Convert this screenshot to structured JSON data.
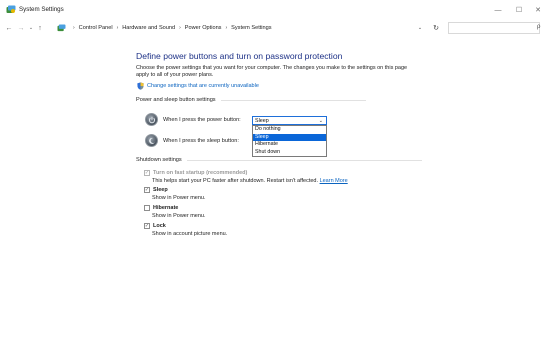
{
  "window": {
    "title": "System Settings",
    "controls": {
      "minimize": "—",
      "maximize": "☐",
      "close": "✕"
    }
  },
  "nav": {
    "back": "←",
    "forward": "→",
    "recent": "⌄",
    "up": "↑",
    "breadcrumbs": [
      "Control Panel",
      "Hardware and Sound",
      "Power Options",
      "System Settings"
    ],
    "separator": "›",
    "address_dropdown": "⌄",
    "refresh": "↻",
    "search_placeholder": "",
    "search_icon": "ρ"
  },
  "main": {
    "title": "Define power buttons and turn on password protection",
    "intro": "Choose the power settings that you want for your computer. The changes you make to the settings on this page apply to all of your power plans.",
    "change_link": "Change settings that are currently unavailable",
    "power_section": {
      "heading": "Power and sleep button settings",
      "power_button_label": "When I press the power button:",
      "sleep_button_label": "When I press the sleep button:",
      "selected": "Sleep",
      "caret": "⌄",
      "options": [
        "Do nothing",
        "Sleep",
        "Hibernate",
        "Shut down"
      ],
      "highlighted_index": 1
    },
    "shutdown_section": {
      "heading": "Shutdown settings",
      "items": [
        {
          "label": "Turn on fast startup (recommended)",
          "checked": true,
          "disabled": true,
          "desc": "This helps start your PC faster after shutdown. Restart isn't affected.",
          "link": "Learn More"
        },
        {
          "label": "Sleep",
          "checked": true,
          "disabled": false,
          "desc": "Show in Power menu."
        },
        {
          "label": "Hibernate",
          "checked": false,
          "disabled": false,
          "desc": "Show in Power menu."
        },
        {
          "label": "Lock",
          "checked": true,
          "disabled": false,
          "desc": "Show in account picture menu."
        }
      ]
    }
  },
  "colors": {
    "title": "#1e3287",
    "link": "#0b64c0",
    "highlight": "#0a66d8"
  }
}
